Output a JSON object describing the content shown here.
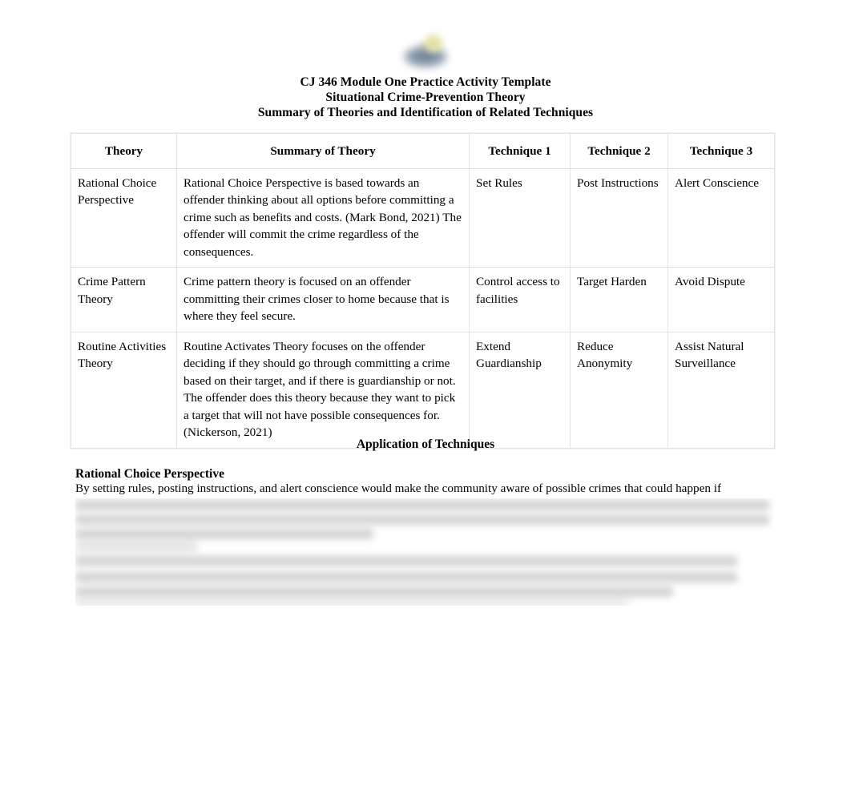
{
  "document": {
    "logo": "snhu-logo-image",
    "titles": [
      "CJ 346 Module One Practice Activity Template",
      "Situational Crime-Prevention Theory",
      "Summary of Theories and Identification of Related Techniques"
    ]
  },
  "table": {
    "headers": [
      "Theory",
      "Summary of Theory",
      "Technique 1",
      "Technique 2",
      "Technique 3"
    ],
    "rows": [
      {
        "theory": "Rational Choice Perspective",
        "summary": "Rational Choice Perspective is based towards an offender thinking about all options before committing a crime such as benefits and costs. (Mark Bond, 2021) The offender will commit the crime regardless of the consequences.",
        "technique1": "Set Rules",
        "technique2": "Post Instructions",
        "technique3": "Alert Conscience"
      },
      {
        "theory": "Crime Pattern Theory",
        "summary": "Crime pattern theory is focused on an offender committing their crimes closer to home because that is where they feel secure.",
        "technique1": "Control access to facilities",
        "technique2": "Target Harden",
        "technique3": "Avoid Dispute"
      },
      {
        "theory": "Routine Activities Theory",
        "summary": "Routine Activates Theory focuses on the offender deciding if they should go through committing a crime based on their target, and if there is guardianship or not. The offender does this theory because they want to pick a target that will not have possible consequences for. (Nickerson, 2021)",
        "technique1": "Extend Guardianship",
        "technique2": "Reduce Anonymity",
        "technique3": "Assist Natural Surveillance"
      }
    ]
  },
  "application": {
    "section_heading": "Application of Techniques",
    "subsection_heading": "Rational Choice Perspective",
    "first_line": "By setting rules, posting instructions, and alert conscience would make the community aware of possible crimes that could happen if",
    "redacted_note": "blurred-unreadable-paragraph"
  }
}
